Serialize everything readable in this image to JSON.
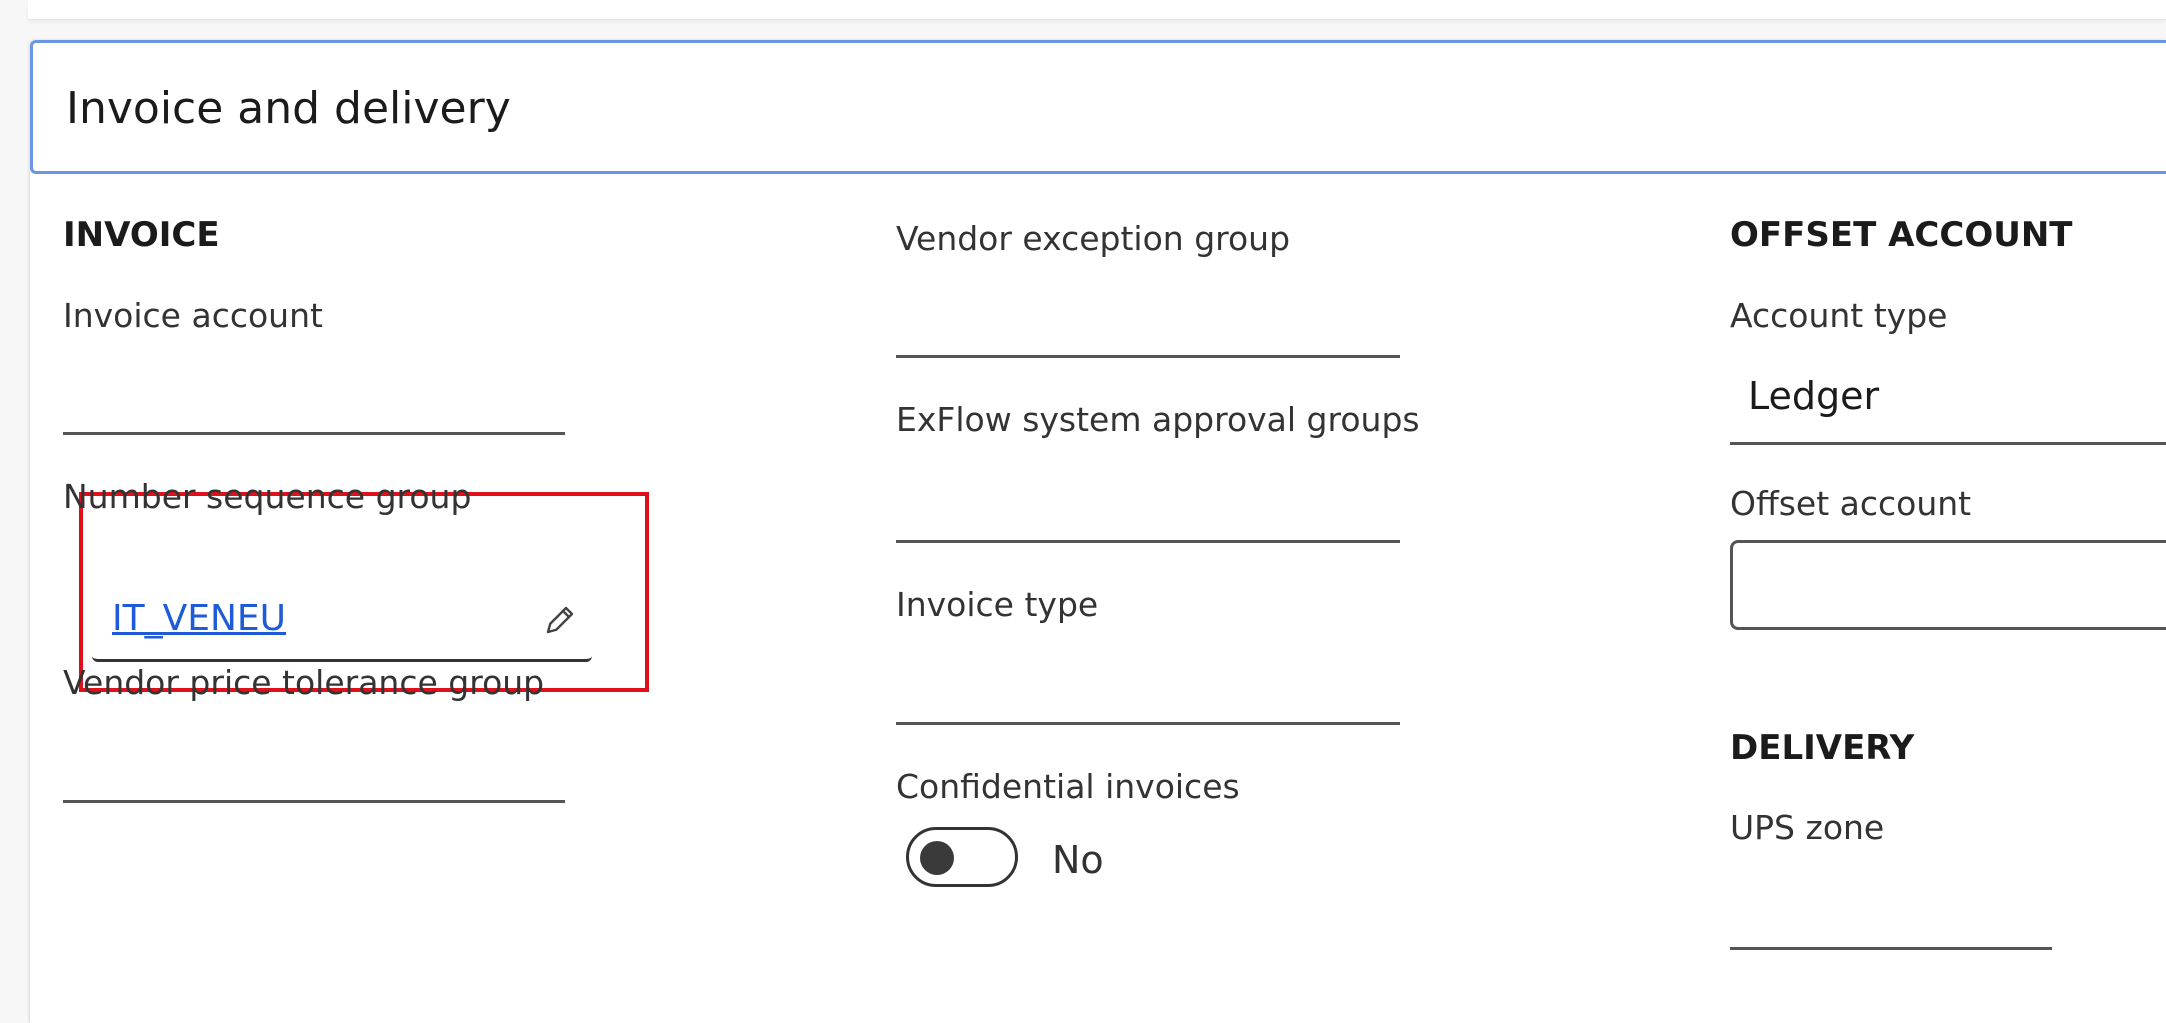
{
  "section": {
    "title": "Invoice and delivery"
  },
  "invoice": {
    "heading": "INVOICE",
    "invoice_account_label": "Invoice account",
    "invoice_account_value": "",
    "number_sequence_group_label": "Number sequence group",
    "number_sequence_group_value": "IT_VENEU",
    "vendor_price_tolerance_group_label": "Vendor price tolerance group",
    "vendor_price_tolerance_group_value": ""
  },
  "middle": {
    "vendor_exception_group_label": "Vendor exception group",
    "exflow_approval_groups_label": "ExFlow system approval groups",
    "invoice_type_label": "Invoice type",
    "confidential_invoices_label": "Confidential invoices",
    "confidential_invoices_state": "No"
  },
  "offset_account": {
    "heading": "OFFSET ACCOUNT",
    "account_type_label": "Account type",
    "account_type_value": "Ledger",
    "offset_account_label": "Offset account",
    "offset_account_value": ""
  },
  "delivery": {
    "heading": "DELIVERY",
    "ups_zone_label": "UPS zone",
    "ups_zone_value": ""
  },
  "icons": {
    "edit": "pencil-icon"
  },
  "colors": {
    "header_border": "#6d95e6",
    "highlight": "#e0101a",
    "link": "#1f5bd8"
  }
}
